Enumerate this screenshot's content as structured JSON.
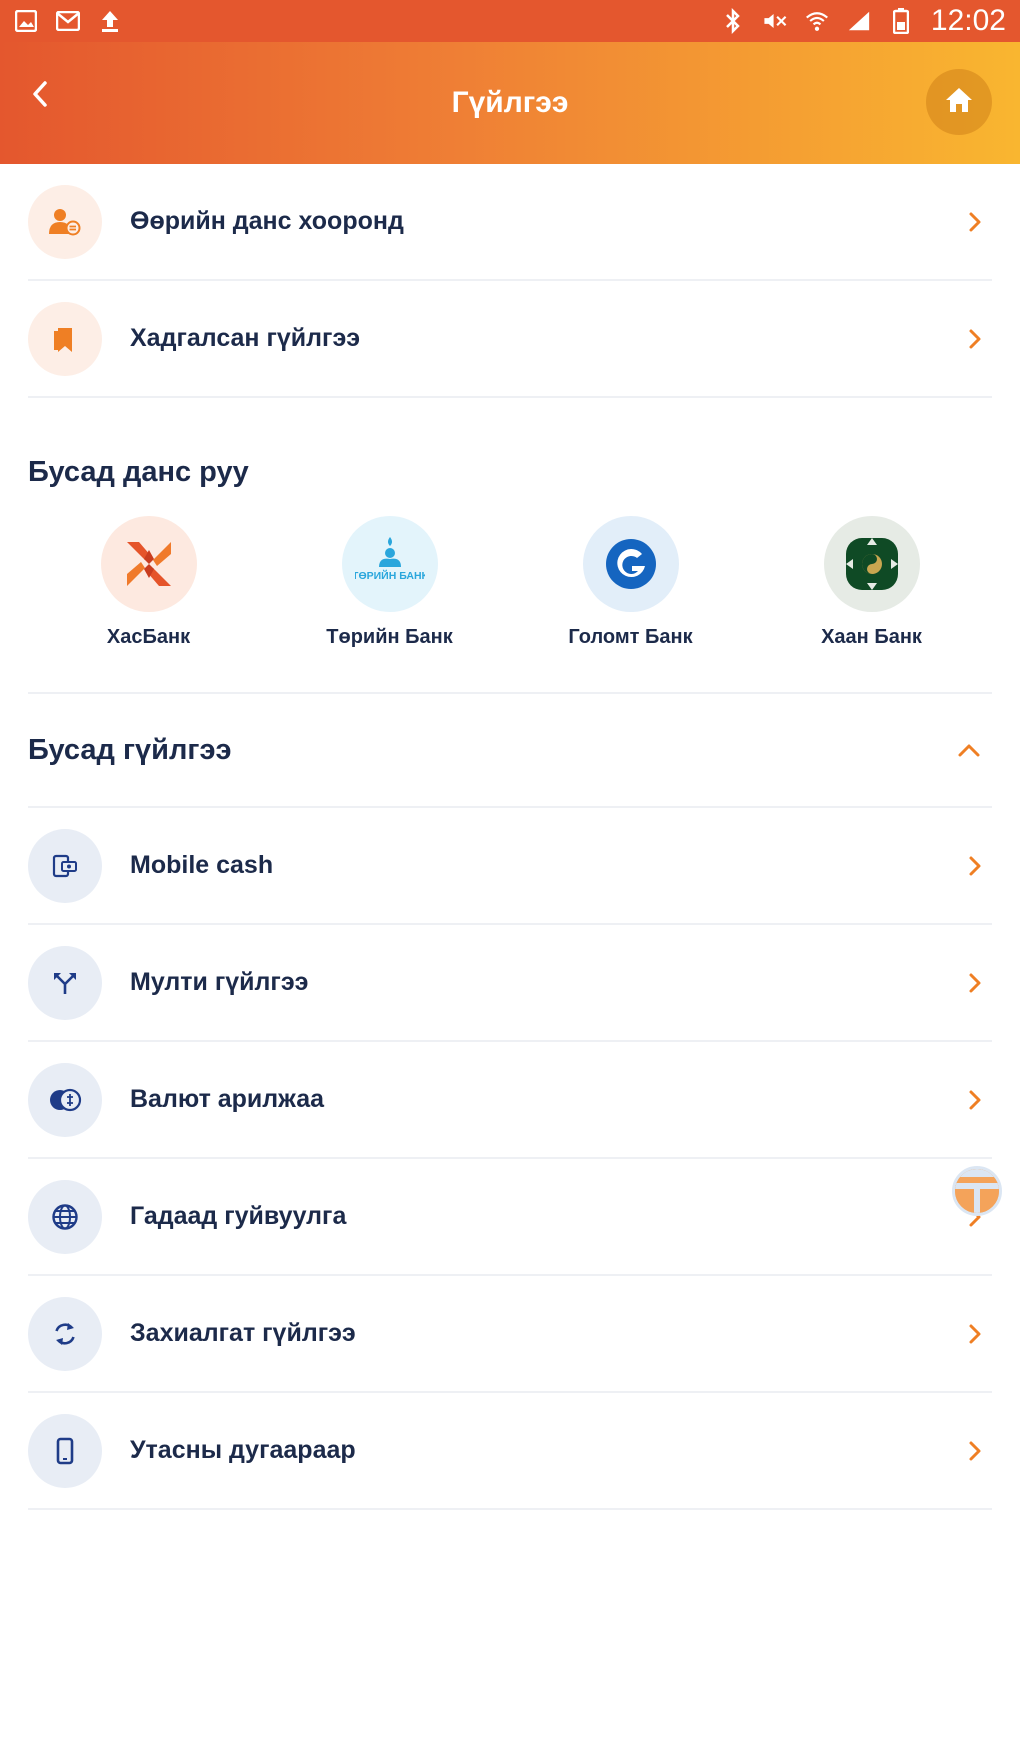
{
  "status_bar": {
    "time": "12:02"
  },
  "header": {
    "title": "Гүйлгээ"
  },
  "top_items": [
    {
      "label": "Өөрийн данс хооронд",
      "icon": "person-transfer-icon"
    },
    {
      "label": "Хадгалсан гүйлгээ",
      "icon": "bookmark-icon"
    }
  ],
  "other_accounts": {
    "title": "Бусад данс руу",
    "banks": [
      {
        "name": "ХасБанк",
        "icon": "xacbank-logo"
      },
      {
        "name": "Төрийн Банк",
        "icon": "turiin-bank-logo",
        "logo_text": "ТӨРИЙН БАНК"
      },
      {
        "name": "Голомт Банк",
        "icon": "golomt-bank-logo"
      },
      {
        "name": "Хаан Банк",
        "icon": "khan-bank-logo"
      }
    ]
  },
  "other_transactions": {
    "title": "Бусад гүйлгээ",
    "items": [
      {
        "label": "Mobile cash",
        "icon": "mobile-cash-icon"
      },
      {
        "label": "Мулти гүйлгээ",
        "icon": "multi-arrow-icon"
      },
      {
        "label": "Валют арилжаа",
        "icon": "currency-exchange-icon"
      },
      {
        "label": "Гадаад гуйвуулга",
        "icon": "globe-icon"
      },
      {
        "label": "Захиалгат гүйлгээ",
        "icon": "refresh-icon"
      },
      {
        "label": "Утасны дугаараар",
        "icon": "phone-icon"
      }
    ]
  },
  "colors": {
    "accent": "#ef7f24",
    "header_start": "#e4572e",
    "header_end": "#f9b630",
    "text": "#1c2a4a",
    "icon_blue": "#1f3c88"
  }
}
